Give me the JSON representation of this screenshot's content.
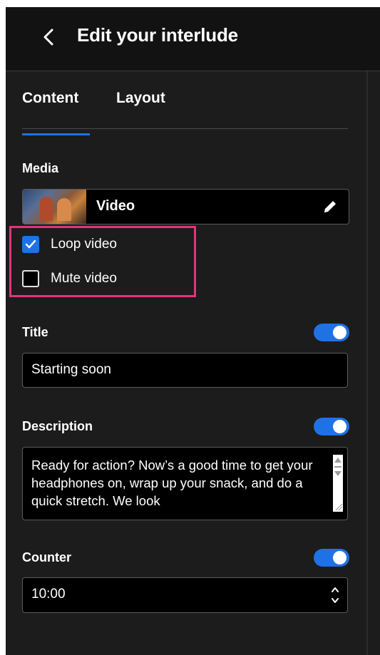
{
  "header": {
    "title": "Edit your interlude",
    "back_icon": "chevron-left-icon"
  },
  "tabs": [
    {
      "label": "Content",
      "active": true
    },
    {
      "label": "Layout",
      "active": false
    }
  ],
  "media": {
    "section_label": "Media",
    "item_label": "Video",
    "edit_icon": "pencil-icon"
  },
  "options": {
    "loop": {
      "label": "Loop video",
      "checked": true
    },
    "mute": {
      "label": "Mute video",
      "checked": false
    }
  },
  "title_section": {
    "label": "Title",
    "enabled": true,
    "value": "Starting soon"
  },
  "description_section": {
    "label": "Description",
    "enabled": true,
    "value": "Ready for action? Now’s a good time to get your headphones on, wrap up your snack, and do a quick stretch. We look"
  },
  "counter_section": {
    "label": "Counter",
    "enabled": true,
    "value": "10:00"
  },
  "colors": {
    "accent": "#1e72e6",
    "panel_bg": "#1c1c1c",
    "header_bg": "#121212",
    "highlight": "#e0357a"
  }
}
